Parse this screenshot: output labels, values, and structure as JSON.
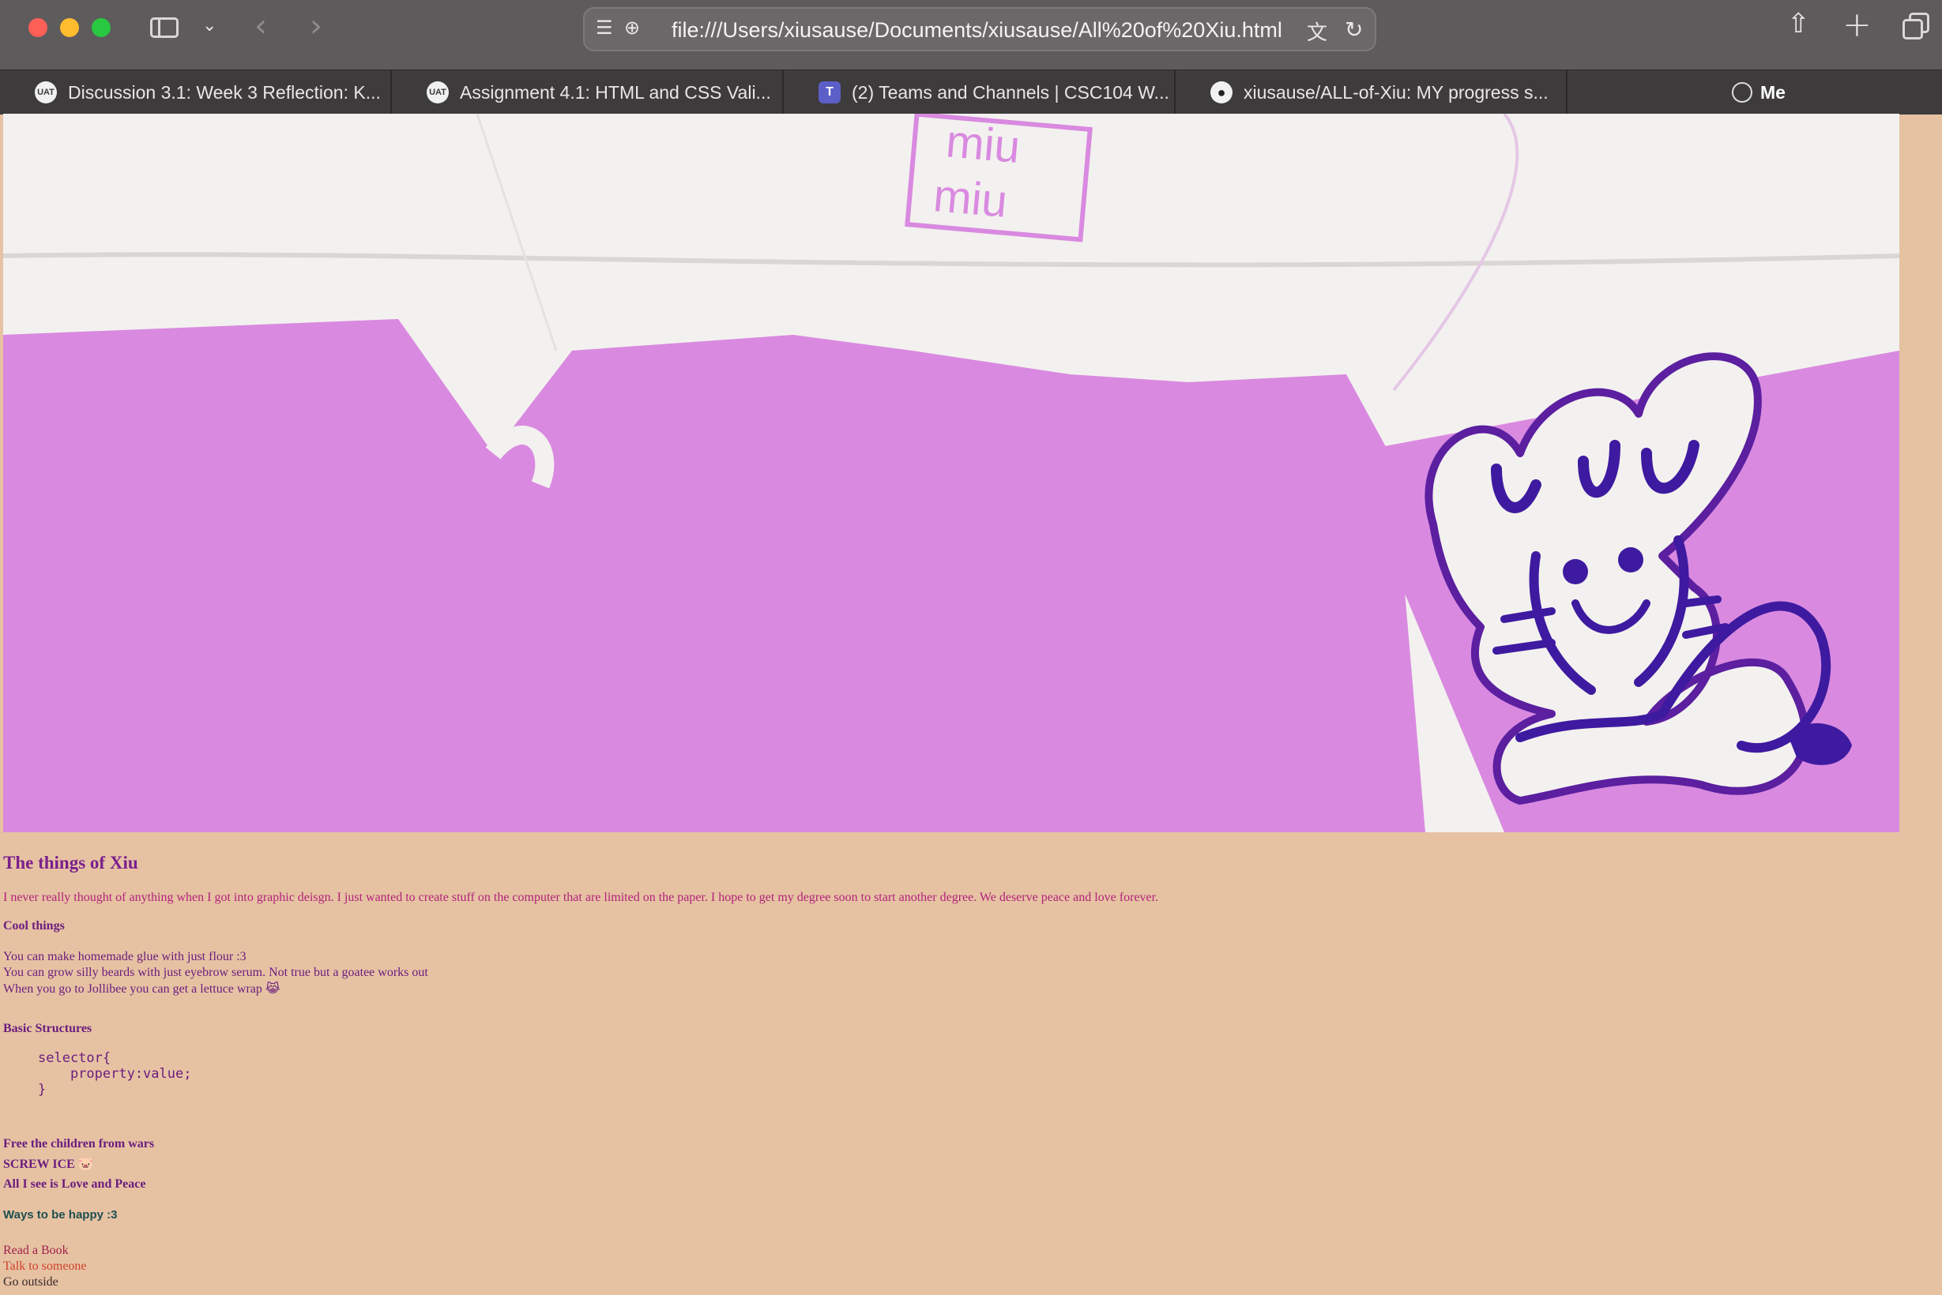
{
  "browser": {
    "address": "file:///Users/xiusause/Documents/xiusause/All%20of%20Xiu.html",
    "tabs": [
      {
        "label": "Discussion 3.1: Week 3 Reflection: K...",
        "icon": "uat-icon"
      },
      {
        "label": "Assignment 4.1: HTML and CSS Vali...",
        "icon": "uat-icon"
      },
      {
        "label": "(2) Teams and Channels | CSC104 W...",
        "icon": "teams-icon"
      },
      {
        "label": "xiusause/ALL-of-Xiu: MY progress s...",
        "icon": "github-icon"
      }
    ],
    "profile_tab": "Me"
  },
  "page": {
    "title": "The things of Xiu",
    "intro": "I never really thought of anything when I got into graphic deisgn. I just wanted to create stuff on the computer that are limited on the paper. I hope to get my degree soon to start another degree. We deserve peace and love forever.",
    "cool_heading": "Cool things",
    "cool_items": [
      "You can make homemade glue with just flour :3",
      "You can grow silly beards with just eyebrow serum. Not true but a goatee works out",
      "When you go to Jollibee you can get a lettuce wrap"
    ],
    "cool_emoji": "😹",
    "basic_heading": "Basic Structures",
    "code": "selector{\n    property:value;\n}",
    "free_lines": [
      "Free the children from wars",
      "SCREW ICE",
      "All I see is Love and Peace"
    ],
    "screw_emoji": "🐷",
    "ways_heading": "Ways to be happy :3",
    "ways": [
      "Read a Book",
      "Talk to someone",
      "Go outside"
    ],
    "hero_stamp_text": "miu miu",
    "colors": {
      "background": "#e6c2a3",
      "accent": "#7a1f8c",
      "pink": "#d98ae0"
    }
  }
}
